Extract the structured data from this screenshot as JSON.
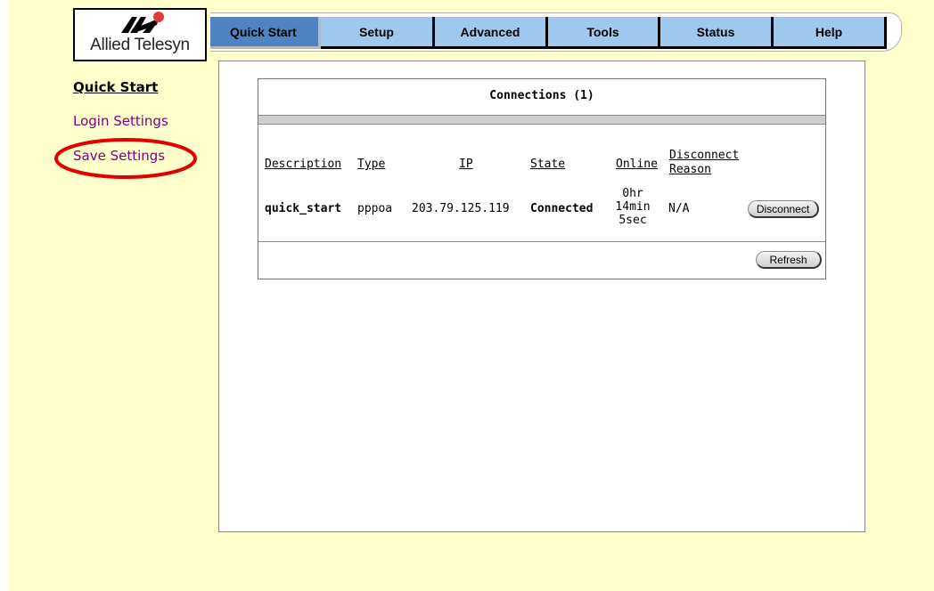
{
  "brand": {
    "logo_text": "Allied Telesyn",
    "logo_icon": "allied-telesyn-logo-icon"
  },
  "nav": {
    "tabs": [
      {
        "label": "Quick Start",
        "active": true
      },
      {
        "label": "Setup",
        "active": false
      },
      {
        "label": "Advanced",
        "active": false
      },
      {
        "label": "Tools",
        "active": false
      },
      {
        "label": "Status",
        "active": false
      },
      {
        "label": "Help",
        "active": false
      }
    ]
  },
  "sidebar": {
    "items": [
      {
        "label": "Quick Start",
        "current": true
      },
      {
        "label": "Login Settings",
        "current": false
      },
      {
        "label": "Save Settings",
        "current": false,
        "highlighted": true
      }
    ]
  },
  "connections": {
    "title": "Connections (1)",
    "columns": [
      "Description",
      "Type",
      "IP",
      "State",
      "Online",
      "Disconnect Reason"
    ],
    "rows": [
      {
        "description": "quick_start",
        "type": "pppoa",
        "ip": "203.79.125.119",
        "state": "Connected",
        "online": [
          "0hr",
          "14min",
          "5sec"
        ],
        "disconnect_reason": "N/A",
        "action_label": "Disconnect"
      }
    ],
    "refresh_label": "Refresh"
  },
  "colors": {
    "page_background": "#ffffcc",
    "tab_active": "#4f83c2",
    "tab_inactive": "#9fc8ee",
    "link_visited": "#800080",
    "highlight_ellipse": "#e00000"
  }
}
